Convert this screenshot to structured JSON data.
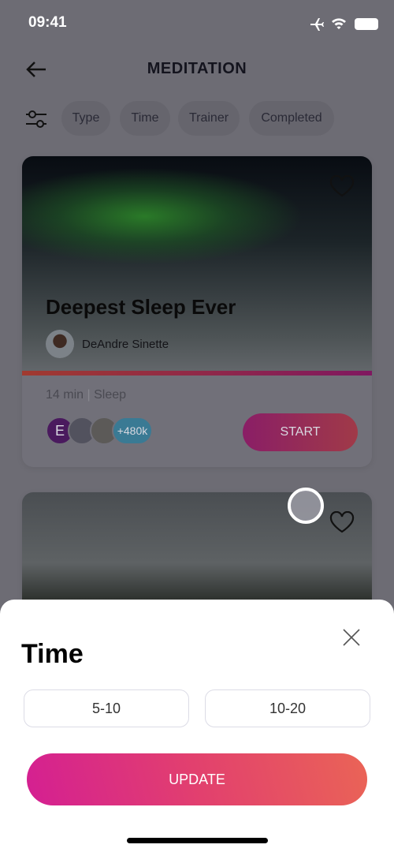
{
  "status_bar": {
    "time": "09:41",
    "icons": [
      "airplane-icon",
      "wifi-icon",
      "battery-icon"
    ]
  },
  "header": {
    "title": "MEDITATION",
    "back_icon": "arrow-left-icon"
  },
  "filters": {
    "icon": "sliders-icon",
    "chips": [
      "Type",
      "Time",
      "Trainer",
      "Completed"
    ]
  },
  "cards": [
    {
      "title": "Deepest Sleep Ever",
      "trainer": "DeAndre Sinette",
      "duration": "14 min",
      "separator": "|",
      "category": "Sleep",
      "participants_initial": "E",
      "participants_more": "+480k",
      "start_label": "START",
      "favorite_icon": "heart-icon"
    },
    {
      "favorite_icon": "heart-icon"
    }
  ],
  "sheet": {
    "title": "Time",
    "close_icon": "close-icon",
    "options": [
      "5-10",
      "10-20"
    ],
    "update_label": "UPDATE"
  },
  "colors": {
    "accent_start": "#d41f92",
    "accent_end": "#ea6456"
  }
}
